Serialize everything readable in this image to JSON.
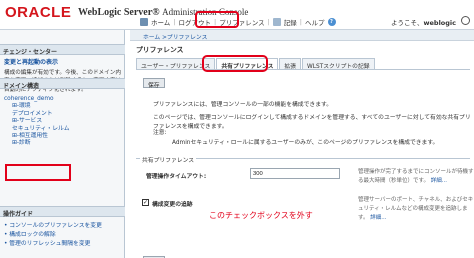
{
  "header": {
    "logo": "ORACLE",
    "product": "WebLogic Server",
    "product_reg": "®",
    "product_sub": "Administration Console",
    "toolbar": [
      "ホーム",
      "ログアウト",
      "プリファレンス",
      "記録",
      "ヘルプ"
    ],
    "welcome_prefix": "ようこそ、",
    "welcome_user": "weblogic"
  },
  "sidebar": {
    "change_center_title": "チェンジ・センター",
    "change_status": "変更と再起動の表示",
    "change_text": "構成の編集が有効です。今後、このドメイン内容を変更、追加または削除すると、変更内容は自動的にアクティブ化されます。",
    "domain_title": "ドメイン構造",
    "domain_tree": [
      {
        "label": "coherence_demo",
        "indent": 0
      },
      {
        "label": "⊞-環境",
        "indent": 1
      },
      {
        "label": "デプロイメント",
        "indent": 1
      },
      {
        "label": "⊞-サービス",
        "indent": 1
      },
      {
        "label": "セキュリティ・レルム",
        "indent": 1
      },
      {
        "label": "⊞-相互運用性",
        "indent": 1
      },
      {
        "label": "⊞-診断",
        "indent": 1
      }
    ],
    "ops_title": "操作ガイド",
    "ops_items": [
      "• コンソールのプリファレンスを変更",
      "• 構成ロックの解除",
      "• 管理のリフレッシュ間隔を変更"
    ]
  },
  "main": {
    "breadcrumb": "ホーム >プリファレンス",
    "title": "プリファレンス",
    "tabs": [
      {
        "label": "ユーザー・プリファレンス",
        "active": false
      },
      {
        "label": "共有プリファレンス",
        "active": true
      },
      {
        "label": "拡張",
        "active": false
      },
      {
        "label": "WLSTスクリプトの記録",
        "active": false
      }
    ],
    "save_label": "保存",
    "intro1": "プリファレンスには、管理コンソールの一部の機能を構成できます。",
    "intro2": "このページでは、管理コンソールにログインして構成するドメインを管理する、すべてのユーザーに対して有効な共有プリファレンスを構成できます。",
    "note_label": "注意:",
    "note_text": "Adminセキュリティ・ロールに属するユーザーのみが、このページのプリファレンスを構成できます。",
    "section_title": "共有プリファレンス",
    "timeout_label": "管理操作タイムアウト:",
    "timeout_value": "300",
    "timeout_desc": "管理操作が完了するまでにコンソールが待機する最大時間（秒単位）です。",
    "timeout_more": "詳細...",
    "lock_label": "構成変更の追跡",
    "lock_checked": "✓",
    "annotation": "このチェックボックスを外す",
    "lock_desc": "管理サーバーのポート、チャネル、およびセキュリティ・レルムなどの構成変更を追跡します。",
    "lock_more": "詳細..."
  }
}
